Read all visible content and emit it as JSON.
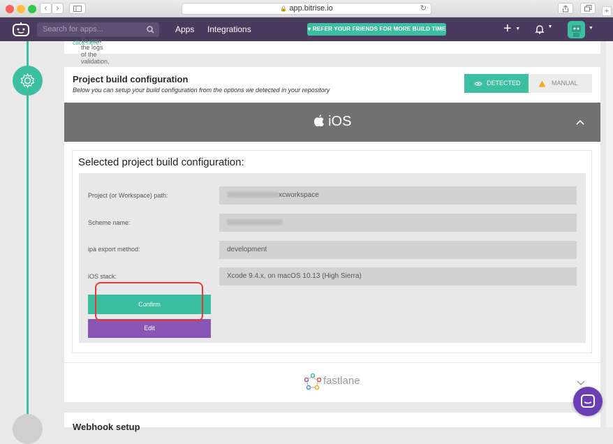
{
  "browser": {
    "url": "app.bitrise.io",
    "back_label": "‹",
    "forward_label": "›"
  },
  "nav": {
    "search_placeholder": "Search for apps...",
    "apps_label": "Apps",
    "integrations_label": "Integrations",
    "refer_prefix": "REFER YOUR FRIENDS FOR ",
    "refer_emphasis": "MORE BUILD TIME",
    "add_label": "+",
    "bell_icon": "bell-icon",
    "colors": {
      "nav_bg": "#493a5e",
      "accent": "#3bbfa0"
    }
  },
  "validation_text": "To view the logs of the validation, ",
  "validation_link": "click here.",
  "build_config": {
    "title": "Project build configuration",
    "subtitle": "Below you can setup your build configuration from the options we detected in your repository",
    "detected_label": "DETECTED",
    "manual_label": "MANUAL",
    "platform_label": "iOS",
    "heading": "Selected project build configuration:",
    "rows": [
      {
        "label": "Project (or Workspace) path:",
        "value": "xcworkspace"
      },
      {
        "label": "Scheme name:",
        "value": ""
      },
      {
        "label": "ipa export method:",
        "value": "development"
      },
      {
        "label": "iOS stack:",
        "value": "Xcode 9.4.x, on macOS 10.13 (High Sierra)"
      }
    ],
    "confirm_label": "Confirm",
    "edit_label": "Edit"
  },
  "fastlane_label": "fastlane",
  "next_section_title": "Webhook setup"
}
